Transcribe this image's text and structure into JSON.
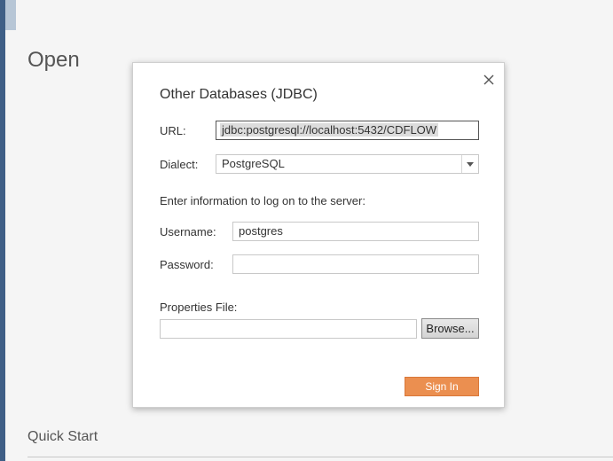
{
  "background": {
    "page_title": "Open",
    "section_title": "Quick Start"
  },
  "dialog": {
    "title": "Other Databases (JDBC)",
    "close_icon": "close-icon",
    "url_label": "URL:",
    "url_value": "jdbc:postgresql://localhost:5432/CDFLOW",
    "dialect_label": "Dialect:",
    "dialect_value": "PostgreSQL",
    "logon_prompt": "Enter information to log on to the server:",
    "username_label": "Username:",
    "username_value": "postgres",
    "password_label": "Password:",
    "password_value": "",
    "properties_label": "Properties File:",
    "properties_value": "",
    "browse_label": "Browse...",
    "signin_label": "Sign In"
  },
  "colors": {
    "accent": "#eb8f50",
    "sidebar": "#3f5f86"
  }
}
